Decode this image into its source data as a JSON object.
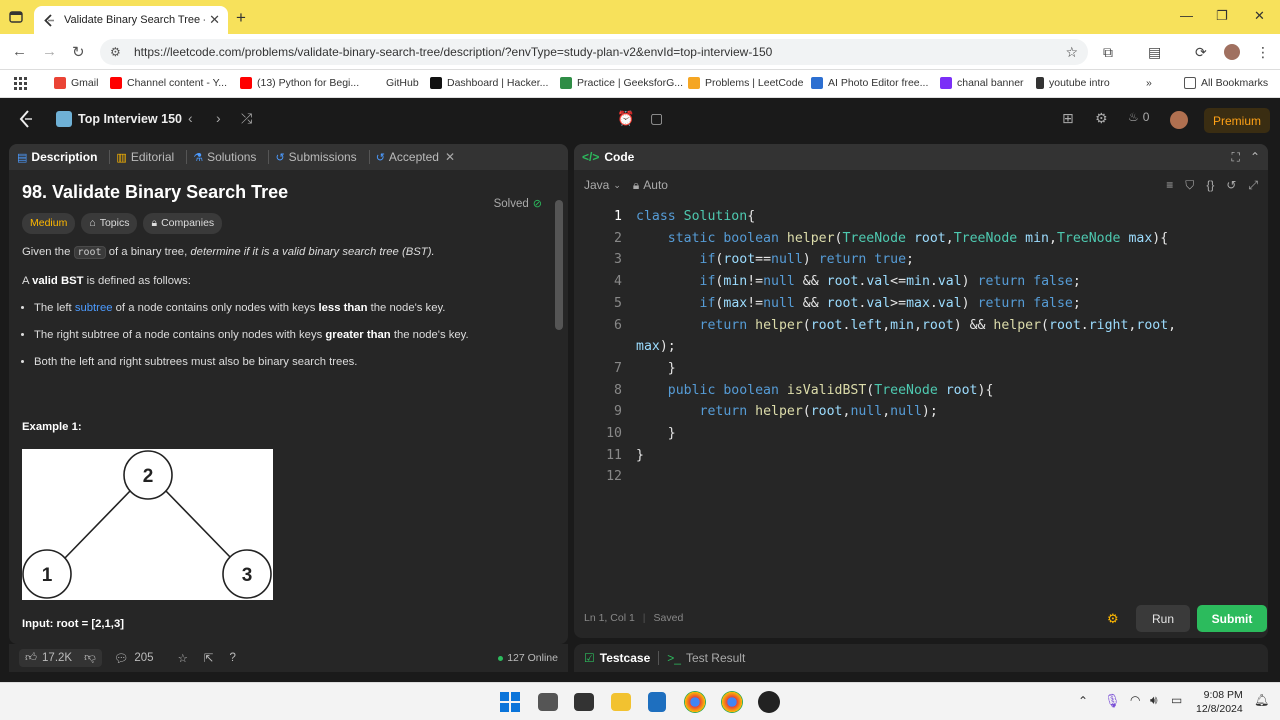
{
  "browser": {
    "tab_title": "Validate Binary Search Tree - Le",
    "url": "https://leetcode.com/problems/validate-binary-search-tree/description/?envType=study-plan-v2&envId=top-interview-150",
    "bookmarks": [
      "Gmail",
      "Channel content - Y...",
      "(13) Python for Begi...",
      "GitHub",
      "Dashboard | Hacker...",
      "Practice | GeeksforG...",
      "Problems | LeetCode",
      "AI Photo Editor free...",
      "chanal banner",
      "youtube intro"
    ],
    "all_bookmarks": "All Bookmarks"
  },
  "header": {
    "study_plan": "Top Interview 150",
    "streak": "0",
    "premium": "Premium"
  },
  "left_tabs": {
    "description": "Description",
    "editorial": "Editorial",
    "solutions": "Solutions",
    "submissions": "Submissions",
    "accepted": "Accepted"
  },
  "problem": {
    "title": "98. Validate Binary Search Tree",
    "solved": "Solved",
    "difficulty": "Medium",
    "topics": "Topics",
    "companies": "Companies",
    "p1_a": "Given the ",
    "p1_code": "root",
    "p1_b": " of a binary tree, ",
    "p1_em": "determine if it is a valid binary search tree (BST).",
    "p2_a": "A ",
    "p2_b": "valid BST",
    "p2_c": " is defined as follows:",
    "b1_a": "The left ",
    "b1_link": "subtree",
    "b1_b": " of a node contains only nodes with keys ",
    "b1_c": "less than",
    "b1_d": " the node's key.",
    "b2_a": "The right subtree of a node contains only nodes with keys ",
    "b2_b": "greater than",
    "b2_c": " the node's key.",
    "b3": "Both the left and right subtrees must also be binary search trees.",
    "example": "Example 1:",
    "tree_nodes": [
      "2",
      "1",
      "3"
    ],
    "cut_input": "Input: root = [2,1,3]"
  },
  "left_footer": {
    "likes": "17.2K",
    "comments": "205",
    "online": "127 Online"
  },
  "code_panel": {
    "title": "Code",
    "language": "Java",
    "mode": "Auto",
    "line_numbers": [
      "1",
      "2",
      "3",
      "4",
      "5",
      "6",
      "",
      "7",
      "8",
      "9",
      "10",
      "11",
      "12"
    ],
    "status_pos": "Ln 1, Col 1",
    "status_saved": "Saved",
    "run": "Run",
    "submit": "Submit"
  },
  "test_bar": {
    "testcase": "Testcase",
    "test_result": "Test Result"
  },
  "clock": {
    "time": "9:08 PM",
    "date": "12/8/2024"
  }
}
